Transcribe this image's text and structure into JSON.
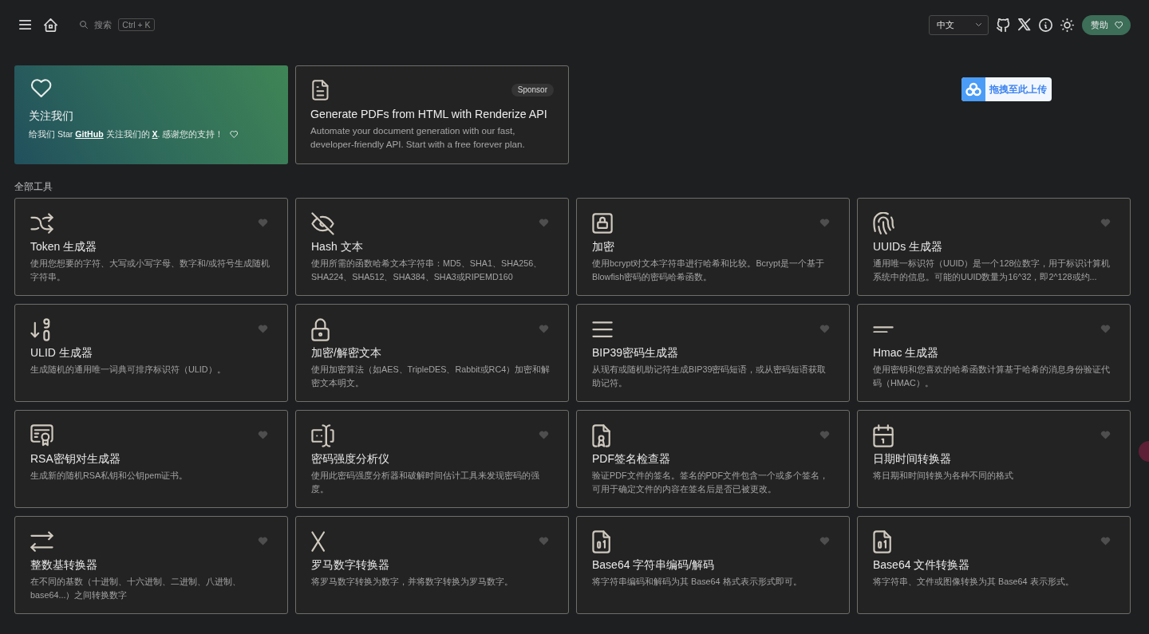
{
  "header": {
    "search": {
      "placeholder": "搜索",
      "shortcut": "Ctrl + K"
    },
    "language": "中文",
    "sponsor_button": "赞助"
  },
  "follow_card": {
    "title": "关注我们",
    "message": [
      {
        "kind": "text",
        "text": "给我们 Star "
      },
      {
        "kind": "link",
        "text": "GitHub"
      },
      {
        "kind": "text",
        "text": " 关注我们的 "
      },
      {
        "kind": "link",
        "text": "X"
      },
      {
        "kind": "text",
        "text": ". 感谢您的支持！"
      }
    ]
  },
  "sponsor_card": {
    "badge": "Sponsor",
    "title": "Generate PDFs from HTML with Renderize API",
    "description": "Automate your document generation with our fast, developer-friendly API. Start with a free forever plan."
  },
  "section_title": "全部工具",
  "tools": [
    {
      "title": "Token 生成器",
      "description": "使用您想要的字符、大写或小写字母、数字和/或符号生成随机字符串。",
      "favorite": false
    },
    {
      "title": "Hash 文本",
      "description": "使用所需的函数哈希文本字符串：MD5、SHA1、SHA256、SHA224、SHA512、SHA384、SHA3或RIPEMD160",
      "favorite": false
    },
    {
      "title": "加密",
      "description": "使用bcrypt对文本字符串进行哈希和比较。Bcrypt是一个基于Blowfish密码的密码哈希函数。",
      "favorite": false
    },
    {
      "title": "UUIDs 生成器",
      "description": "通用唯一标识符（UUID）是一个128位数字，用于标识计算机系统中的信息。可能的UUID数量为16^32，即2^128或约...",
      "favorite": false
    },
    {
      "title": "ULID 生成器",
      "description": "生成随机的通用唯一词典可排序标识符（ULID）。",
      "favorite": false
    },
    {
      "title": "加密/解密文本",
      "description": "使用加密算法（如AES、TripleDES、Rabbit或RC4）加密和解密文本明文。",
      "favorite": false
    },
    {
      "title": "BIP39密码生成器",
      "description": "从现有或随机助记符生成BIP39密码短语，或从密码短语获取助记符。",
      "favorite": false
    },
    {
      "title": "Hmac 生成器",
      "description": "使用密钥和您喜欢的哈希函数计算基于哈希的消息身份验证代码（HMAC）。",
      "favorite": false
    },
    {
      "title": "RSA密钥对生成器",
      "description": "生成新的随机RSA私钥和公钥pem证书。",
      "favorite": false
    },
    {
      "title": "密码强度分析仪",
      "description": "使用此密码强度分析器和破解时间估计工具来发现密码的强度。",
      "favorite": false
    },
    {
      "title": "PDF签名检查器",
      "description": "验证PDF文件的签名。签名的PDF文件包含一个或多个签名，可用于确定文件的内容在签名后是否已被更改。",
      "favorite": false
    },
    {
      "title": "日期时间转换器",
      "description": "将日期和时间转换为各种不同的格式",
      "favorite": false
    },
    {
      "title": "整数基转换器",
      "description": "在不同的基数（十进制、十六进制、二进制、八进制、base64...）之间转换数字",
      "favorite": false
    },
    {
      "title": "罗马数字转换器",
      "description": "将罗马数字转换为数字，并将数字转换为罗马数字。",
      "favorite": false
    },
    {
      "title": "Base64 字符串编码/解码",
      "description": "将字符串编码和解码为其 Base64 格式表示形式即可。",
      "favorite": false
    },
    {
      "title": "Base64 文件转换器",
      "description": "将字符串、文件或图像转换为其 Base64 表示形式。",
      "favorite": false
    }
  ],
  "upload_button": {
    "label": "拖拽至此上传"
  }
}
